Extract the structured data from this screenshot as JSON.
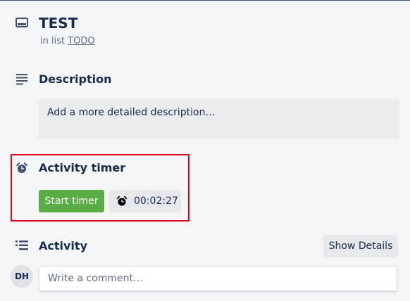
{
  "card": {
    "title": "TEST",
    "in_list_prefix": "in list",
    "list_name": "TODO",
    "title_icon": "card-icon"
  },
  "description": {
    "heading": "Description",
    "placeholder": "Add a more detailed description…",
    "icon": "description-icon"
  },
  "timer": {
    "heading": "Activity timer",
    "start_label": "Start timer",
    "elapsed": "00:02:27",
    "icon": "alarm-clock-icon",
    "start_color": "#5aac44",
    "highlight_color": "#e2001a"
  },
  "activity": {
    "heading": "Activity",
    "show_details_label": "Show Details",
    "icon": "activity-list-icon"
  },
  "comment": {
    "avatar_initials": "DH",
    "placeholder": "Write a comment…"
  }
}
